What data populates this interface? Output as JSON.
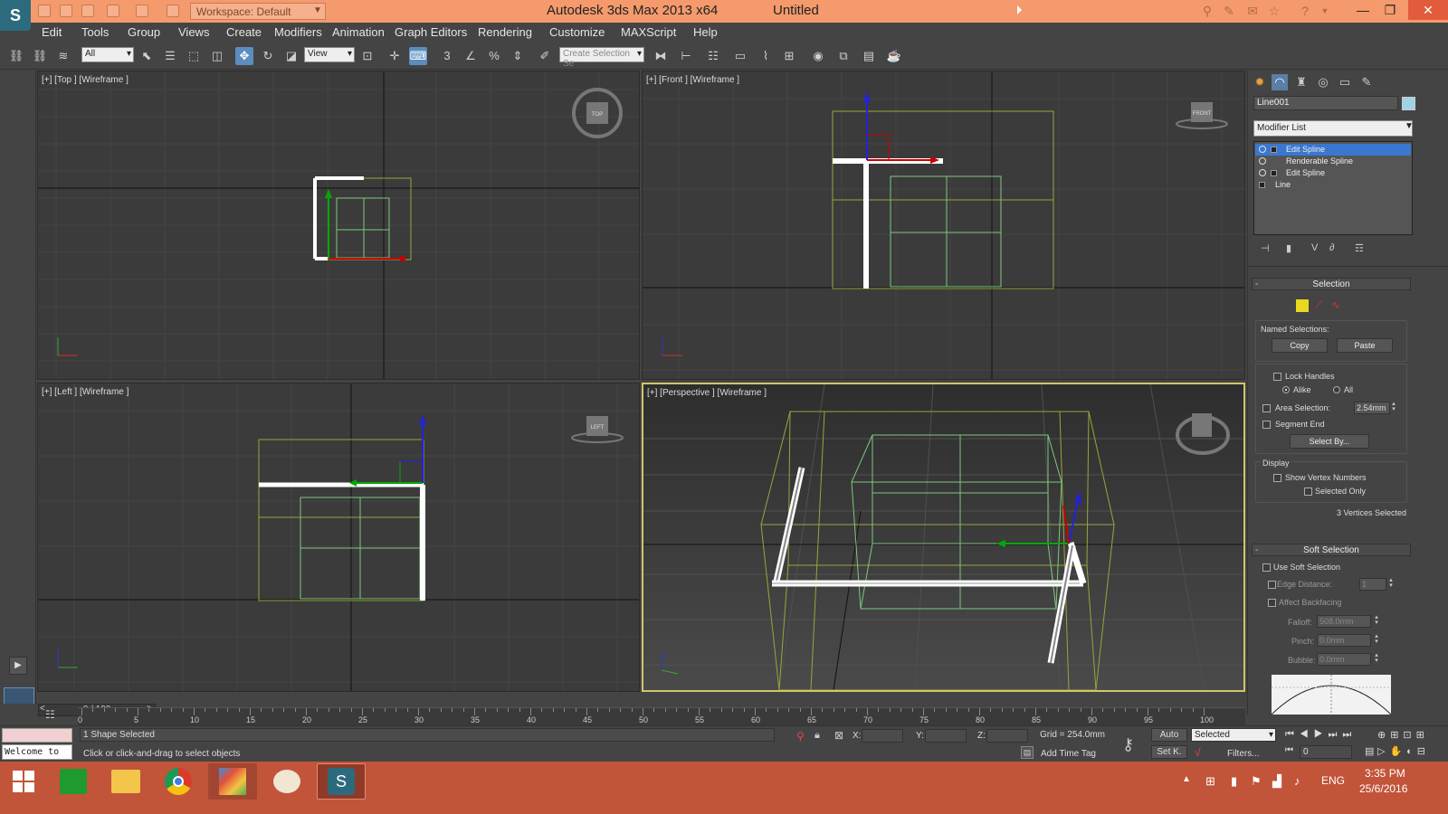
{
  "window": {
    "app_title": "Autodesk 3ds Max  2013 x64",
    "doc_title": "Untitled",
    "workspace": "Workspace: Default",
    "logo_letter": "S"
  },
  "menu": [
    "Edit",
    "Tools",
    "Group",
    "Views",
    "Create",
    "Modifiers",
    "Animation",
    "Graph Editors",
    "Rendering",
    "Customize",
    "MAXScript",
    "Help"
  ],
  "toolbar": {
    "filter_select": "All",
    "ref_coord_select": "View",
    "selection_set_placeholder": "Create Selection Se"
  },
  "viewports": {
    "top": {
      "label": "[+] [Top ] [Wireframe ]",
      "cube": "TOP"
    },
    "front": {
      "label": "[+] [Front ] [Wireframe ]",
      "cube": "FRONT"
    },
    "left": {
      "label": "[+] [Left ] [Wireframe ]",
      "cube": "LEFT"
    },
    "persp": {
      "label": "[+] [Perspective ] [Wireframe ]"
    }
  },
  "command_panel": {
    "object_name": "Line001",
    "object_color": "#9dd4e8",
    "modifier_list": "Modifier List",
    "stack": [
      {
        "label": "Edit Spline",
        "selected": true
      },
      {
        "label": "Renderable Spline",
        "selected": false
      },
      {
        "label": "Edit Spline",
        "selected": false
      },
      {
        "label": "Line",
        "selected": false
      }
    ],
    "selection": {
      "title": "Selection",
      "named_selections": "Named Selections:",
      "copy": "Copy",
      "paste": "Paste",
      "lock_handles": "Lock Handles",
      "alike": "Alike",
      "all": "All",
      "area_selection": "Area Selection:",
      "area_value": "2.54mm",
      "segment_end": "Segment End",
      "select_by": "Select By...",
      "display": "Display",
      "show_vertex_numbers": "Show Vertex Numbers",
      "selected_only": "Selected Only",
      "status": "3 Vertices Selected"
    },
    "soft_selection": {
      "title": "Soft Selection",
      "use_soft": "Use Soft Selection",
      "edge_distance": "Edge Distance:",
      "edge_value": "1",
      "affect_backfacing": "Affect Backfacing",
      "falloff": "Falloff:",
      "falloff_value": "508.0mm",
      "pinch": "Pinch:",
      "pinch_value": "0.0mm",
      "bubble": "Bubble:",
      "bubble_value": "0.0mm"
    }
  },
  "timeline": {
    "slider": "0 / 100",
    "ticks": [
      "0",
      "5",
      "10",
      "15",
      "20",
      "25",
      "30",
      "35",
      "40",
      "45",
      "50",
      "55",
      "60",
      "65",
      "70",
      "75",
      "80",
      "85",
      "90",
      "95",
      "100"
    ]
  },
  "status": {
    "maxscript_listener": "Welcome to",
    "selected": "1 Shape Selected",
    "prompt": "Click or click-and-drag to select objects",
    "x_label": "X:",
    "y_label": "Y:",
    "z_label": "Z:",
    "grid": "Grid = 254.0mm",
    "add_time_tag": "Add Time Tag",
    "auto": "Auto",
    "set_key": "Set K.",
    "selected_dropdown": "Selected",
    "filters": "Filters...",
    "frame": "0"
  },
  "taskbar": {
    "lang": "ENG",
    "time": "3:35 PM",
    "date": "25/6/2016"
  }
}
